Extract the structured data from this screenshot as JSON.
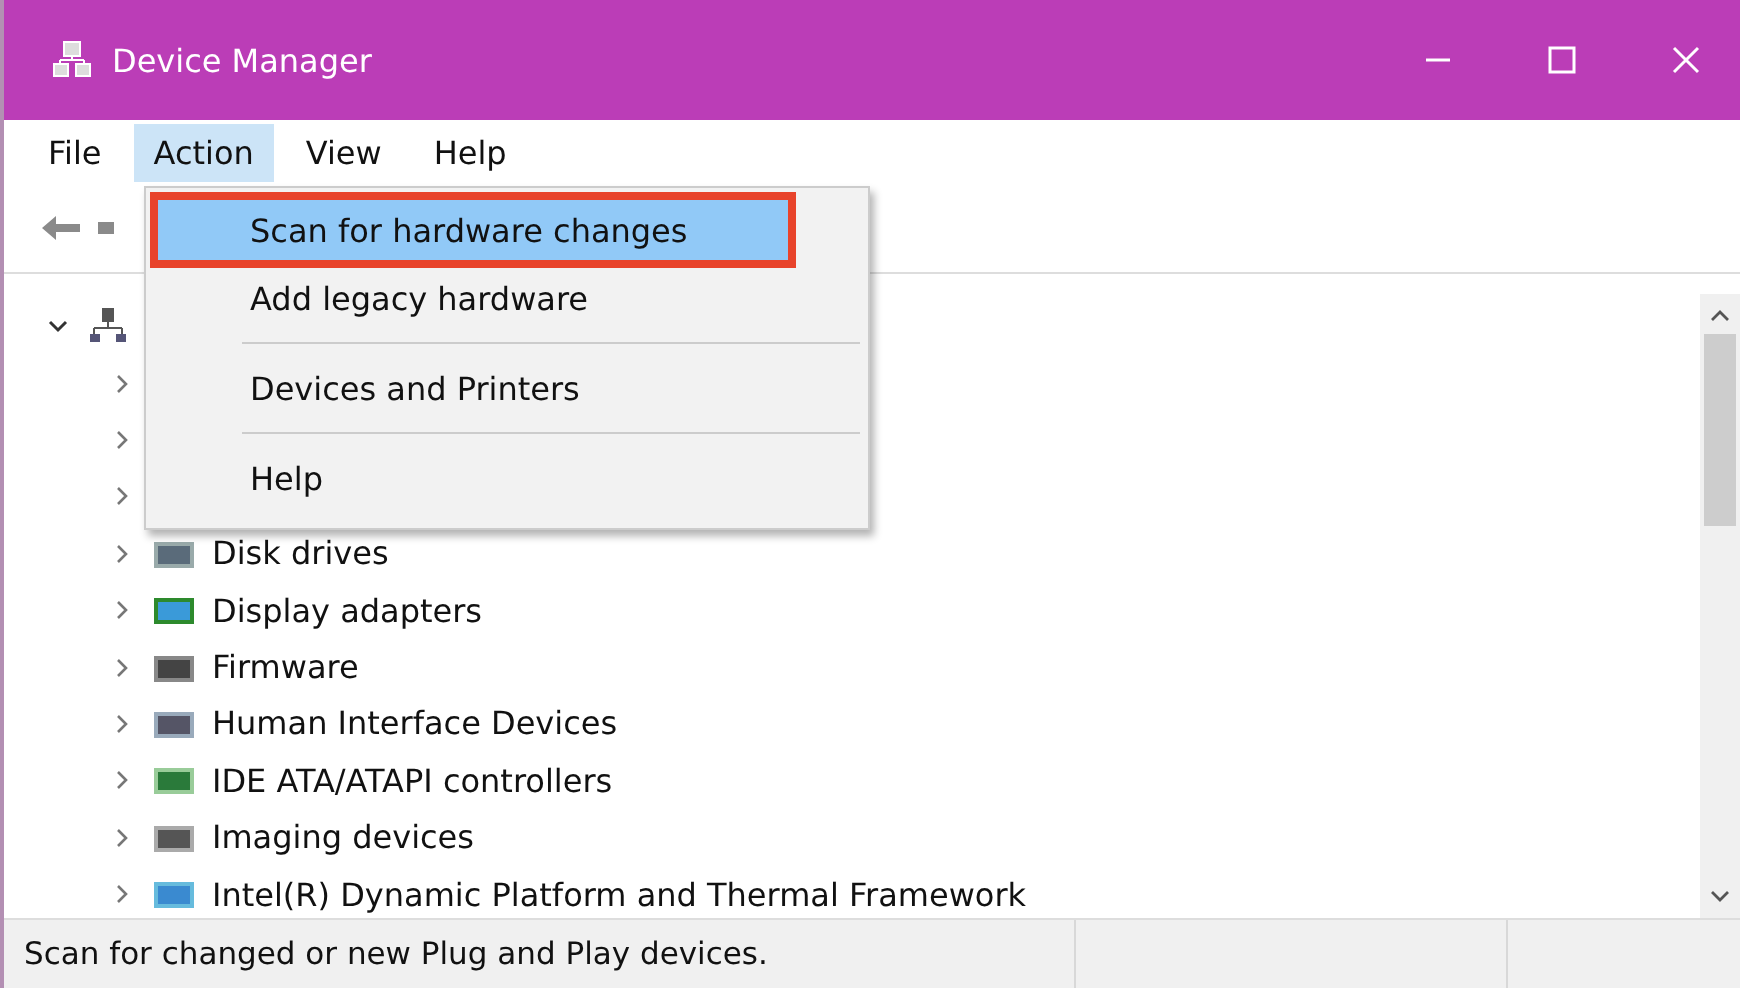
{
  "window": {
    "title": "Device Manager"
  },
  "menu_bar": [
    {
      "label": "File",
      "selected": false
    },
    {
      "label": "Action",
      "selected": true
    },
    {
      "label": "View",
      "selected": false
    },
    {
      "label": "Help",
      "selected": false
    }
  ],
  "action_menu": {
    "items": [
      {
        "kind": "item",
        "label": "Scan for hardware changes",
        "selected": true,
        "highlighted_box": true
      },
      {
        "kind": "item",
        "label": "Add legacy hardware",
        "selected": false,
        "highlighted_box": false
      },
      {
        "kind": "separator"
      },
      {
        "kind": "item",
        "label": "Devices and Printers",
        "selected": false,
        "highlighted_box": false
      },
      {
        "kind": "separator"
      },
      {
        "kind": "item",
        "label": "Help",
        "selected": false,
        "highlighted_box": false
      }
    ]
  },
  "tree": [
    {
      "expanded": true,
      "children": [
        {
          "expanded": false
        },
        {
          "expanded": false
        },
        {
          "expanded": false
        },
        {
          "label": "Disk drives",
          "expanded": false
        },
        {
          "label": "Display adapters",
          "expanded": false
        },
        {
          "label": "Firmware",
          "expanded": false
        },
        {
          "label": "Human Interface Devices",
          "expanded": false
        },
        {
          "label": "IDE ATA/ATAPI controllers",
          "expanded": false
        },
        {
          "label": "Imaging devices",
          "expanded": false
        },
        {
          "label": "Intel(R) Dynamic Platform and Thermal Framework",
          "expanded": false
        }
      ]
    }
  ],
  "status_bar": {
    "text": "Scan for changed or new Plug and Play devices."
  }
}
